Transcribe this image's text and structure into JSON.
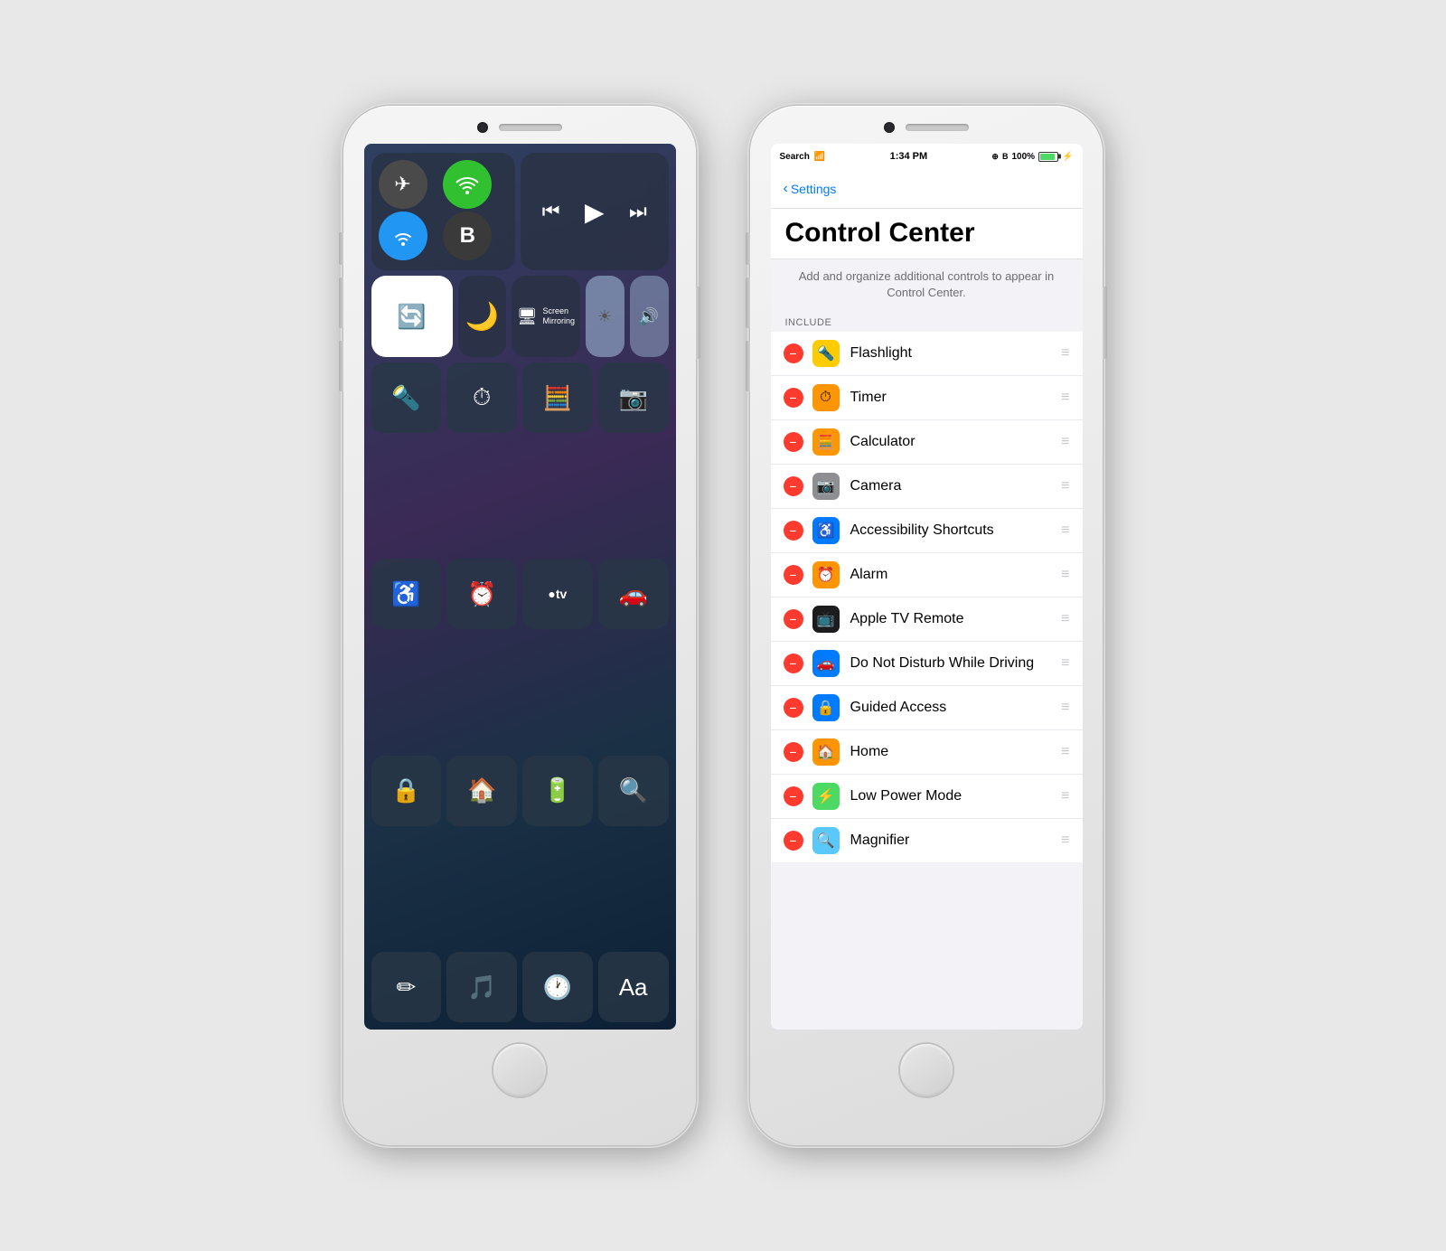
{
  "phone1": {
    "label": "Control Center Phone"
  },
  "phone2": {
    "label": "Settings Phone",
    "statusBar": {
      "search": "Search",
      "wifi": "wifi",
      "time": "1:34 PM",
      "battery": "100%"
    },
    "navBack": "Settings",
    "pageTitle": "Control Center",
    "pageSubtitle": "Add and organize additional controls to appear in Control Center.",
    "sectionHeader": "INCLUDE",
    "items": [
      {
        "label": "Flashlight",
        "iconBg": "icon-yellow",
        "iconChar": "🔦"
      },
      {
        "label": "Timer",
        "iconBg": "icon-orange-clock",
        "iconChar": "⏱"
      },
      {
        "label": "Calculator",
        "iconBg": "icon-orange-calc",
        "iconChar": "🧮"
      },
      {
        "label": "Camera",
        "iconBg": "icon-gray",
        "iconChar": "📷"
      },
      {
        "label": "Accessibility Shortcuts",
        "iconBg": "icon-blue",
        "iconChar": "♿"
      },
      {
        "label": "Alarm",
        "iconBg": "icon-orange-alarm",
        "iconChar": "⏰"
      },
      {
        "label": "Apple TV Remote",
        "iconBg": "icon-dark",
        "iconChar": "📺"
      },
      {
        "label": "Do Not Disturb While Driving",
        "iconBg": "icon-blue-car",
        "iconChar": "🚗"
      },
      {
        "label": "Guided Access",
        "iconBg": "icon-blue-lock",
        "iconChar": "🔒"
      },
      {
        "label": "Home",
        "iconBg": "icon-orange-home",
        "iconChar": "🏠"
      },
      {
        "label": "Low Power Mode",
        "iconBg": "icon-green",
        "iconChar": "⚡"
      },
      {
        "label": "Magnifier",
        "iconBg": "icon-blue2",
        "iconChar": "🔍"
      }
    ],
    "removeBtnLabel": "−"
  }
}
